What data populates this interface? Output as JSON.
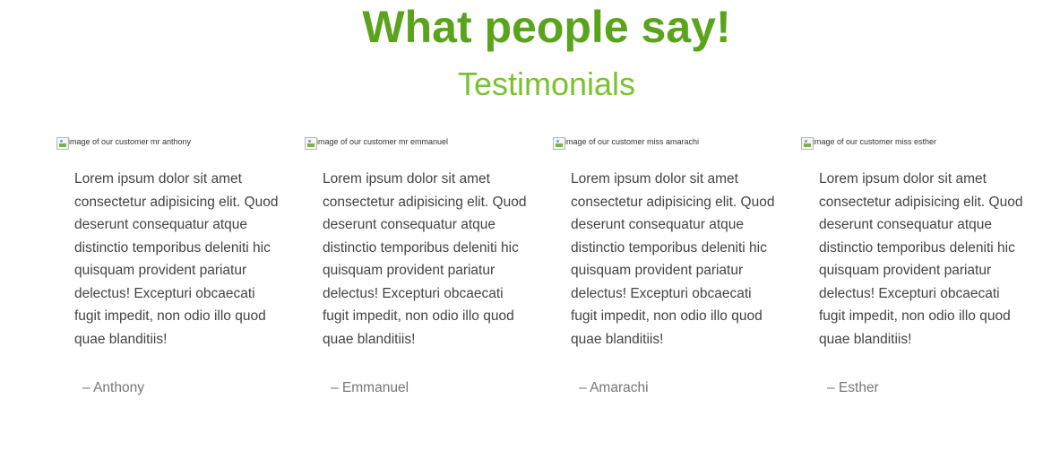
{
  "header": {
    "title": "What people say!",
    "subtitle": "Testimonials"
  },
  "testimonials": [
    {
      "image_alt": "image of our customer mr anthony",
      "quote": "Lorem ipsum dolor sit amet consectetur adipisicing elit. Quod deserunt consequatur atque distinctio temporibus deleniti hic quisquam provident pariatur delectus! Excepturi obcaecati fugit impedit, non odio illo quod quae blanditiis!",
      "author": "– Anthony"
    },
    {
      "image_alt": "image of our customer mr emmanuel",
      "quote": "Lorem ipsum dolor sit amet consectetur adipisicing elit. Quod deserunt consequatur atque distinctio temporibus deleniti hic quisquam provident pariatur delectus! Excepturi obcaecati fugit impedit, non odio illo quod quae blanditiis!",
      "author": "– Emmanuel"
    },
    {
      "image_alt": "image of our customer miss amarachi",
      "quote": "Lorem ipsum dolor sit amet consectetur adipisicing elit. Quod deserunt consequatur atque distinctio temporibus deleniti hic quisquam provident pariatur delectus! Excepturi obcaecati fugit impedit, non odio illo quod quae blanditiis!",
      "author": "– Amarachi"
    },
    {
      "image_alt": "image of our customer miss esther",
      "quote": "Lorem ipsum dolor sit amet consectetur adipisicing elit. Quod deserunt consequatur atque distinctio temporibus deleniti hic quisquam provident pariatur delectus! Excepturi obcaecati fugit impedit, non odio illo quod quae blanditiis!",
      "author": "– Esther"
    }
  ],
  "colors": {
    "title": "#5aa41b",
    "subtitle": "#7ac22e",
    "body_text": "#444444",
    "author_text": "#777777"
  }
}
